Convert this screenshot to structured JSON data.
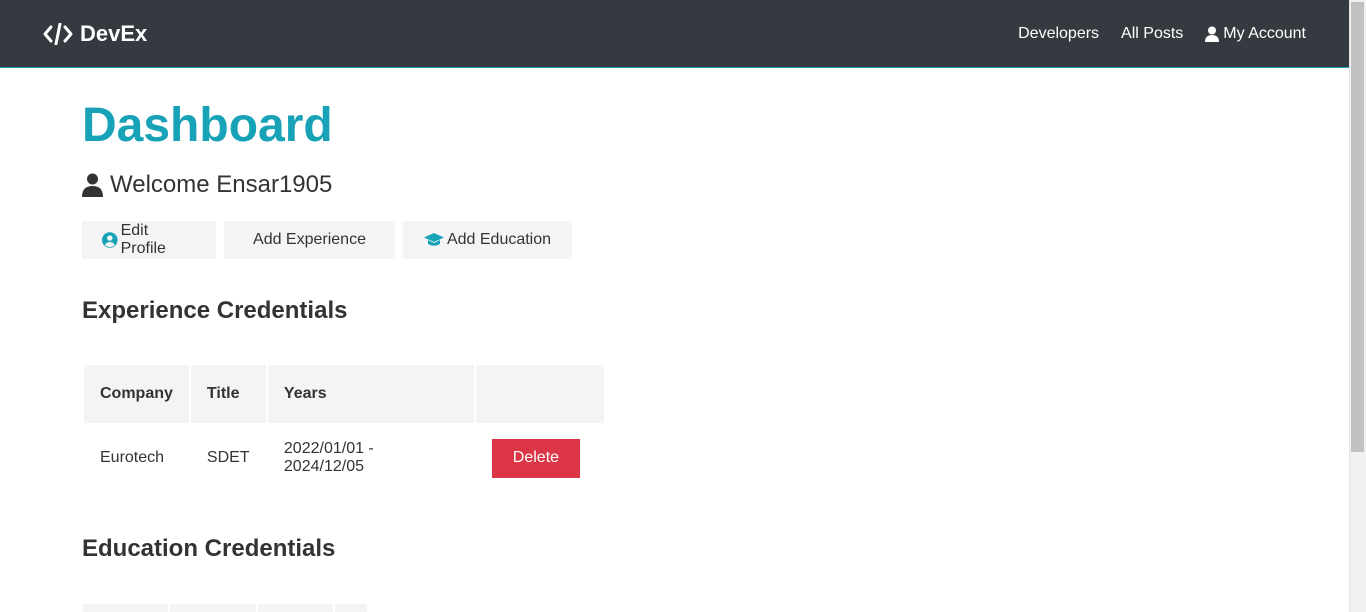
{
  "navbar": {
    "brand": "DevEx",
    "links": [
      "Developers",
      "All Posts"
    ],
    "account_label": "My Account"
  },
  "dashboard": {
    "title": "Dashboard",
    "welcome": "Welcome Ensar1905",
    "buttons": {
      "edit_profile": "Edit Profile",
      "add_experience": "Add Experience",
      "add_education": "Add Education"
    }
  },
  "experience": {
    "title": "Experience Credentials",
    "headers": [
      "Company",
      "Title",
      "Years",
      ""
    ],
    "rows": [
      {
        "company": "Eurotech",
        "title": "SDET",
        "years": "2022/01/01 - 2024/12/05",
        "action": "Delete"
      }
    ]
  },
  "education": {
    "title": "Education Credentials"
  },
  "colors": {
    "primary": "#17a2b8",
    "dark": "#343a40",
    "danger": "#dc3545",
    "light": "#f4f4f4"
  }
}
